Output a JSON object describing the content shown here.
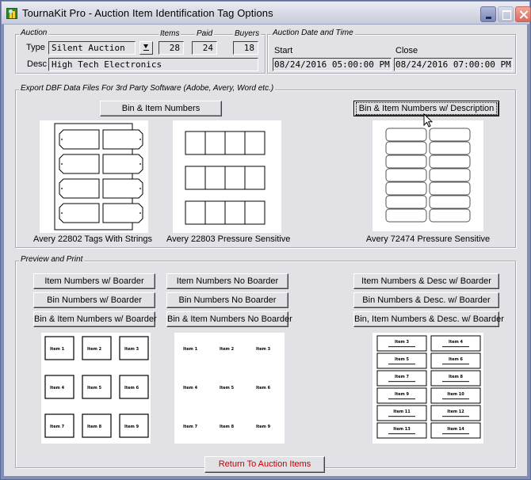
{
  "window": {
    "title": "TournaKit Pro - Auction Item Identification Tag Options",
    "controls": [
      "minimize",
      "maximize",
      "close"
    ]
  },
  "auction": {
    "group_title": "Auction",
    "type_label": "Type",
    "type_value": "Silent Auction",
    "desc_label": "Desc",
    "desc_value": "High Tech Electronics",
    "items_label": "Items",
    "items_value": "28",
    "paid_label": "Paid",
    "paid_value": "24",
    "buyers_label": "Buyers",
    "buyers_value": "18"
  },
  "datetime": {
    "group_title": "Auction Date and Time",
    "start_label": "Start",
    "start_value": "08/24/2016 05:00:00 PM",
    "close_label": "Close",
    "close_value": "08/24/2016 07:00:00 PM"
  },
  "export": {
    "group_title": "Export DBF Data Files For 3rd Party Software (Adobe, Avery, Word etc.)",
    "buttons": {
      "bin_item": "Bin & Item Numbers",
      "bin_item_desc": "Bin & Item Numbers w/ Description"
    },
    "templates": [
      {
        "caption": "Avery 22802 Tags With Strings"
      },
      {
        "caption": "Avery 22803 Pressure Sensitive"
      },
      {
        "caption": "Avery 72474 Pressure Sensitive"
      }
    ]
  },
  "preview": {
    "group_title": "Preview and Print",
    "buttons_col1": [
      "Item Numbers w/ Boarder",
      "Bin Numbers w/ Boarder",
      "Bin & Item Numbers w/ Boarder"
    ],
    "buttons_col2": [
      "Item Numbers No Boarder",
      "Bin Numbers No Boarder",
      "Bin & Item Numbers No Boarder"
    ],
    "buttons_col3": [
      "Item Numbers & Desc w/ Boarder",
      "Bin Numbers & Desc. w/ Boarder",
      "Bin, Item Numbers & Desc. w/ Boarder"
    ],
    "grid_labels": [
      "Item 1",
      "Item 2",
      "Item 3",
      "Item 4",
      "Item 5",
      "Item 6",
      "Item 7",
      "Item 8",
      "Item 9"
    ],
    "desc_labels": [
      "Item 3",
      "Item 4",
      "Item 5",
      "Item 6",
      "Item 7",
      "Item 8",
      "Item 9",
      "Item 10",
      "Item 11",
      "Item 12",
      "Item 13",
      "Item 14"
    ]
  },
  "footer": {
    "return_button": "Return To Auction Items",
    "return_color": "#c00000"
  }
}
